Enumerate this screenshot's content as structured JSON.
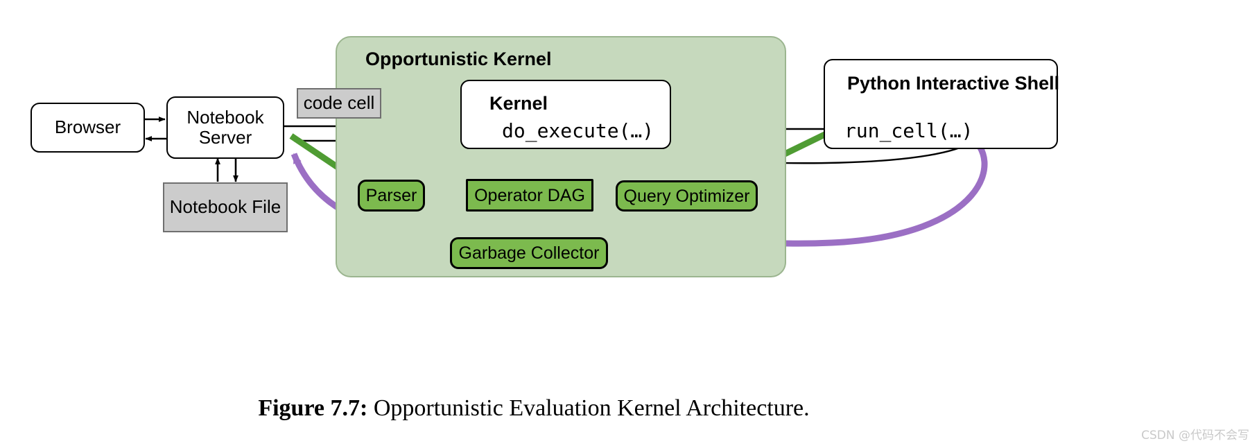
{
  "figure": {
    "caption_label": "Figure 7.7:",
    "caption_text": "Opportunistic Evaluation Kernel Architecture.",
    "watermark": "CSDN @代码不会写"
  },
  "colors": {
    "group_fill": "#c6d9bd",
    "group_border": "#9bb58f",
    "green_node_fill": "#7cba4e",
    "green_arrow": "#4f9c33",
    "purple_arrow": "#9b6fc4",
    "gray_node_fill": "#cccccc",
    "black": "#000000",
    "white": "#ffffff"
  },
  "nodes": {
    "browser": {
      "label": "Browser",
      "kind": "white-rounded"
    },
    "notebook_server": {
      "label_line1": "Notebook",
      "label_line2": "Server",
      "kind": "white-rounded"
    },
    "notebook_file": {
      "label": "Notebook File",
      "kind": "gray-rect"
    },
    "code_cell": {
      "label": "code cell",
      "kind": "gray-rect"
    },
    "kernel_panel": {
      "title": "Kernel",
      "method": "do_execute(…)",
      "kind": "white-rounded"
    },
    "python_shell_panel": {
      "title": "Python Interactive Shell",
      "method": "run_cell(…)",
      "kind": "white-rounded"
    },
    "parser": {
      "label": "Parser",
      "kind": "green-rounded"
    },
    "operator_dag": {
      "label": "Operator DAG",
      "kind": "green-square"
    },
    "query_optimizer": {
      "label": "Query Optimizer",
      "kind": "green-rounded"
    },
    "garbage_collector": {
      "label": "Garbage Collector",
      "kind": "green-rounded"
    }
  },
  "groups": {
    "opportunistic_kernel": {
      "title": "Opportunistic Kernel"
    }
  },
  "edges": [
    {
      "from": "browser",
      "to": "notebook_server",
      "color": "black"
    },
    {
      "from": "notebook_server",
      "to": "browser",
      "color": "black"
    },
    {
      "from": "notebook_file",
      "to": "notebook_server",
      "color": "black"
    },
    {
      "from": "notebook_server",
      "to": "notebook_file",
      "color": "black"
    },
    {
      "from": "notebook_server",
      "to": "kernel_panel",
      "color": "black"
    },
    {
      "from": "kernel_panel",
      "to": "notebook_server",
      "color": "black"
    },
    {
      "from": "kernel_panel",
      "to": "python_shell_panel",
      "color": "black"
    },
    {
      "from": "python_shell_panel",
      "to": "kernel_panel",
      "color": "black"
    },
    {
      "from": "notebook_server",
      "to": "parser",
      "color": "green"
    },
    {
      "from": "parser",
      "to": "notebook_server",
      "color": "green"
    },
    {
      "from": "parser",
      "to": "operator_dag",
      "color": "green"
    },
    {
      "from": "operator_dag",
      "to": "query_optimizer",
      "color": "green"
    },
    {
      "from": "query_optimizer",
      "to": "python_shell_panel",
      "color": "green"
    },
    {
      "from": "operator_dag",
      "to": "garbage_collector",
      "color": "green"
    },
    {
      "from": "garbage_collector",
      "to": "operator_dag",
      "color": "green"
    },
    {
      "from": "operator_dag",
      "to": "notebook_server",
      "color": "purple"
    },
    {
      "from": "python_shell_panel",
      "to": "operator_dag",
      "color": "purple"
    }
  ]
}
